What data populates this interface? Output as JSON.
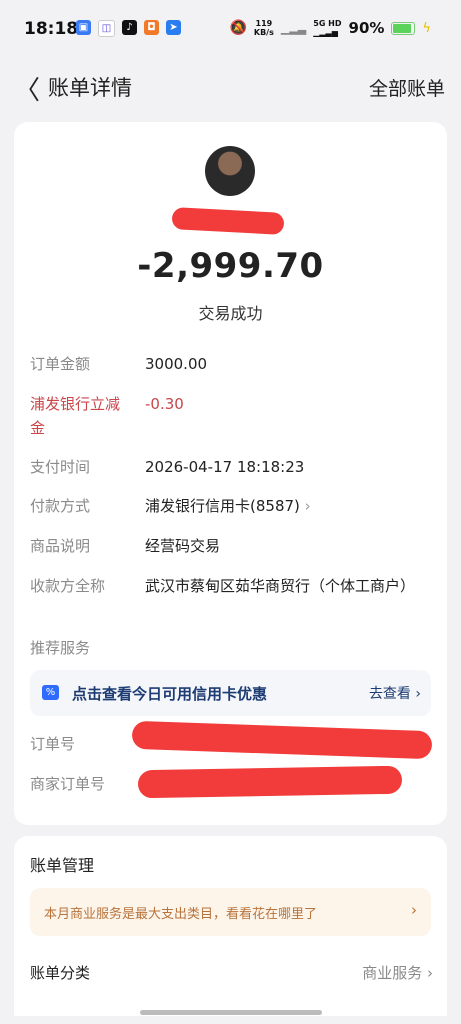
{
  "status_bar": {
    "time": "18:18",
    "net_speed_value": "119",
    "net_speed_unit": "KB/s",
    "network": "5G HD",
    "battery": "90%"
  },
  "nav": {
    "title": "账单详情",
    "right_label": "全部账单"
  },
  "transaction": {
    "amount": "-2,999.70",
    "status": "交易成功"
  },
  "details": [
    {
      "label": "订单金额",
      "value": "3000.00"
    },
    {
      "label": "浦发银行立减金",
      "value": "-0.30"
    },
    {
      "label": "支付时间",
      "value": "2026-04-17 18:18:23"
    },
    {
      "label": "付款方式",
      "value": "浦发银行信用卡(8587)"
    },
    {
      "label": "商品说明",
      "value": "经营码交易"
    },
    {
      "label": "收款方全称",
      "value": "武汉市蔡甸区茹华商贸行（个体工商户）"
    }
  ],
  "recommend": {
    "section_label": "推荐服务",
    "promo_text": "点击查看今日可用信用卡优惠",
    "promo_link": "去查看"
  },
  "order_ids": {
    "order_no_label": "订单号",
    "merchant_order_no_label": "商家订单号"
  },
  "manage": {
    "title": "账单管理",
    "tip": "本月商业服务是最大支出类目，看看花在哪里了",
    "category_label": "账单分类",
    "category_value": "商业服务"
  },
  "colors": {
    "discount_red": "#c9464a",
    "promo_blue": "#2f6bff",
    "tip_orange": "#b8743b",
    "redaction": "#f23b3b"
  }
}
